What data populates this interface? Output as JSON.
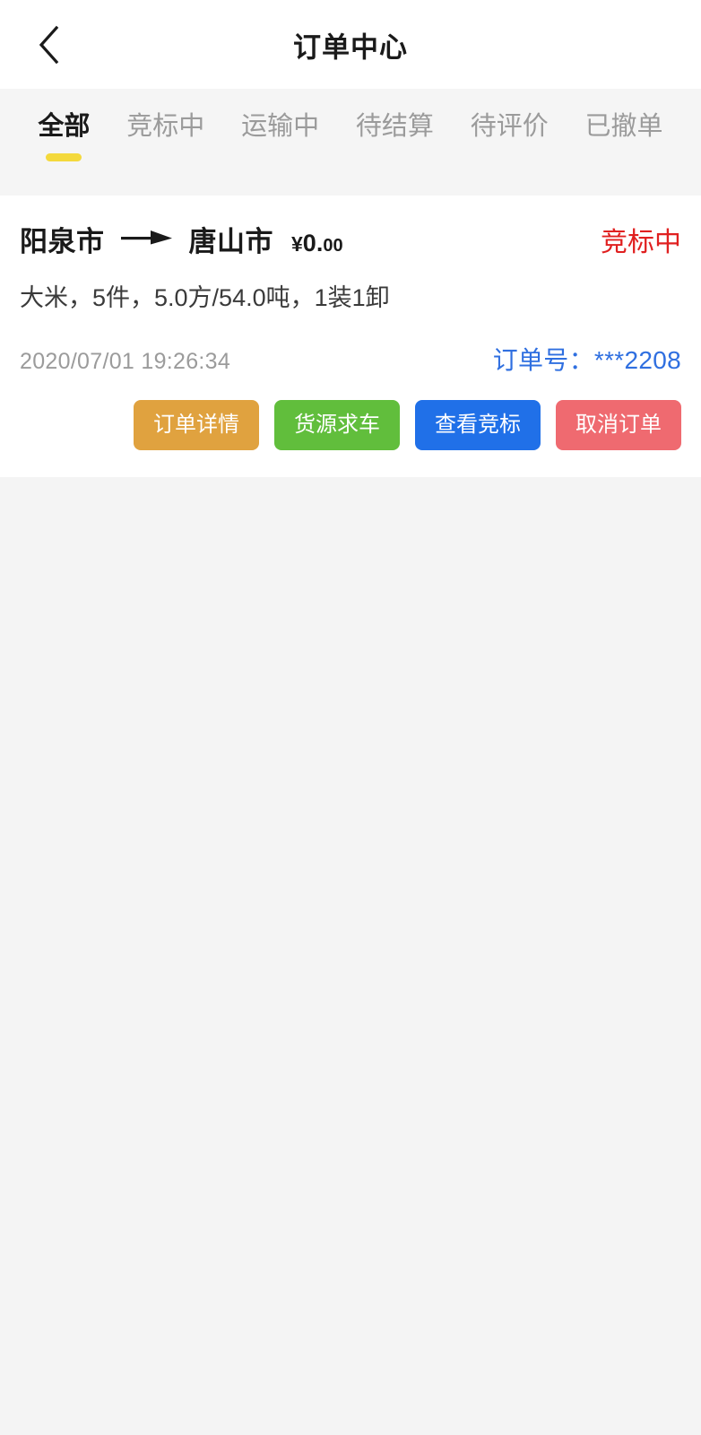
{
  "header": {
    "title": "订单中心",
    "back_icon": "chevron-left-icon"
  },
  "tabs": [
    {
      "label": "全部",
      "active": true
    },
    {
      "label": "竞标中",
      "active": false
    },
    {
      "label": "运输中",
      "active": false
    },
    {
      "label": "待结算",
      "active": false
    },
    {
      "label": "待评价",
      "active": false
    },
    {
      "label": "已撤单",
      "active": false
    }
  ],
  "order": {
    "origin": "阳泉市",
    "arrow_icon": "arrow-right-icon",
    "destination": "唐山市",
    "price_currency": "¥",
    "price_int": "0.",
    "price_dec": "00",
    "status": "竞标中",
    "cargo": "大米，5件，5.0方/54.0吨，1装1卸",
    "timestamp": "2020/07/01 19:26:34",
    "order_no_label": "订单号：",
    "order_no_value": "***2208",
    "buttons": [
      {
        "label": "订单详情"
      },
      {
        "label": "货源求车"
      },
      {
        "label": "查看竞标"
      },
      {
        "label": "取消订单"
      }
    ]
  },
  "colors": {
    "tab_active_underline": "#f4d93c",
    "status_red": "#e02020",
    "order_no_blue": "#2f6fe0",
    "btn_detail": "#e0a23f",
    "btn_source": "#61be3c",
    "btn_bid": "#2070e8",
    "btn_cancel": "#ef6a70",
    "page_bg": "#f4f4f4"
  }
}
